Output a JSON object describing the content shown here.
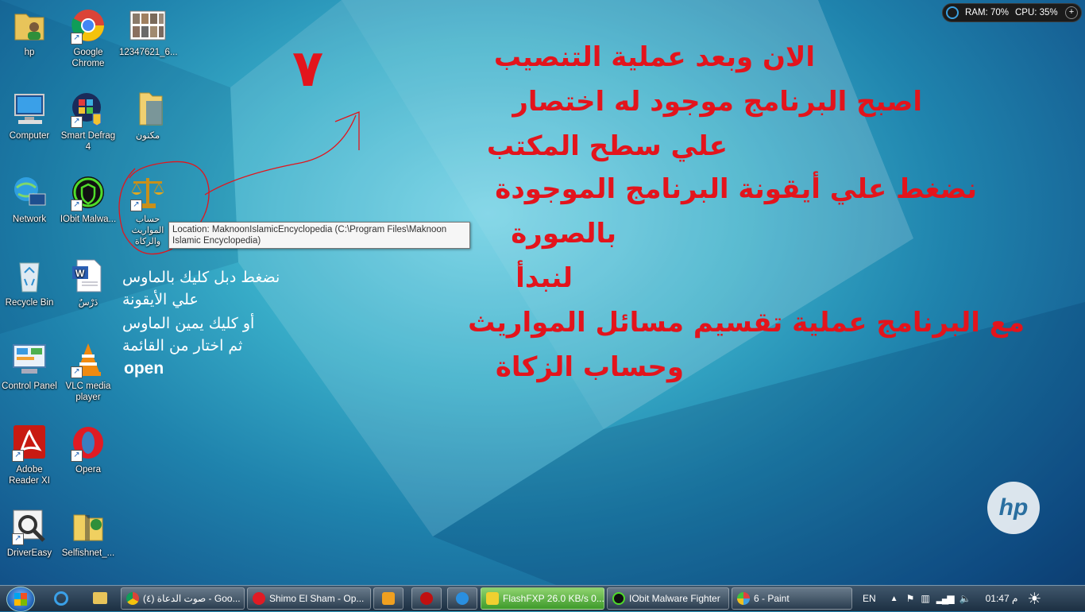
{
  "desktop_icons": [
    {
      "label": "hp",
      "icon": "user-folder-icon"
    },
    {
      "label": "Google Chrome",
      "icon": "chrome-icon"
    },
    {
      "label": "12347621_6...",
      "icon": "image-thumbnail-icon"
    },
    {
      "label": "Computer",
      "icon": "computer-icon"
    },
    {
      "label": "Smart Defrag 4",
      "icon": "smart-defrag-icon"
    },
    {
      "label": "مكنون",
      "icon": "folder-icon"
    },
    {
      "label": "Network",
      "icon": "network-icon"
    },
    {
      "label": "IObit Malwa...",
      "icon": "iobit-icon"
    },
    {
      "label": "حساب المواريث والزكاة",
      "icon": "scales-icon"
    },
    {
      "label": "Recycle Bin",
      "icon": "recycle-bin-icon"
    },
    {
      "label": "دَرْسٌ",
      "icon": "word-document-icon"
    },
    {
      "label": "Control Panel",
      "icon": "control-panel-icon"
    },
    {
      "label": "VLC media player",
      "icon": "vlc-icon"
    },
    {
      "label": "Adobe Reader XI",
      "icon": "adobe-reader-icon"
    },
    {
      "label": "Opera",
      "icon": "opera-icon"
    },
    {
      "label": "DriverEasy",
      "icon": "drivereasy-icon"
    },
    {
      "label": "Selfishnet_...",
      "icon": "zip-folder-icon"
    }
  ],
  "tooltip": {
    "text": "Location: MaknoonIslamicEncyclopedia (C:\\Program Files\\Maknoon Islamic Encyclopedia)"
  },
  "annotation": {
    "step_number": "٧",
    "red_lines": [
      "الان وبعد عملية التنصيب",
      "اصبح البرنامج موجود له اختصار",
      "علي سطح المكتب",
      " نضغط علي أيقونة البرنامج الموجودة",
      "بالصورة",
      " لنبدأ",
      "مع البرنامج عملية تقسيم مسائل المواريث",
      "وحساب الزكاة"
    ],
    "white_lines": [
      "نضغط  دبل كليك بالماوس",
      "علي الأيقونة",
      "أو كليك يمين الماوس",
      "ثم اختار من القائمة"
    ],
    "white_open": "open"
  },
  "system_monitor": {
    "ram": "RAM: 70%",
    "cpu": "CPU: 35%"
  },
  "brand_logo": {
    "text": "hp"
  },
  "taskbar": {
    "items": [
      {
        "label": "(٤) صوت الدعاة - Goo...",
        "icon": "chrome-icon"
      },
      {
        "label": "Shimo El Sham - Op...",
        "icon": "opera-icon"
      },
      {
        "label": "",
        "icon": "media-player-icon"
      },
      {
        "label": "",
        "icon": "red-app-icon"
      },
      {
        "label": "",
        "icon": "refresh-app-icon"
      },
      {
        "label": "FlashFXP 26.0 KB/s 0...",
        "icon": "flashfxp-icon"
      },
      {
        "label": "IObit Malware Fighter",
        "icon": "iobit-icon"
      },
      {
        "label": "6 - Paint",
        "icon": "paint-icon"
      }
    ],
    "language": "EN",
    "clock": "01:47 م"
  },
  "colors": {
    "annotation_red": "#e3141c",
    "taskbar": "#2a4157",
    "flashfxp_green": "#5cb840"
  }
}
